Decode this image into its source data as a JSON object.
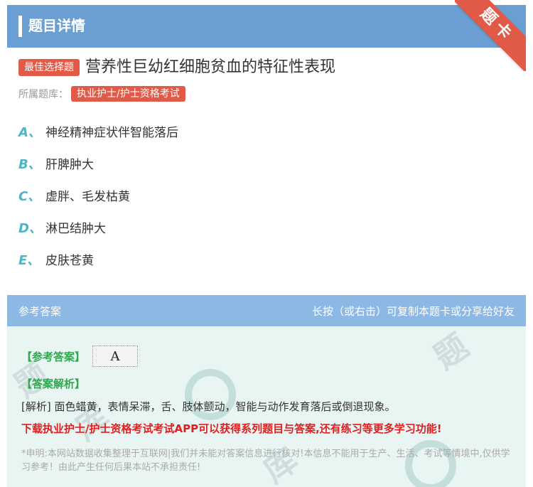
{
  "header": {
    "title": "题目详情"
  },
  "ribbon": {
    "label": "题卡"
  },
  "question": {
    "type_tag": "最佳选择题",
    "title": "营养性巨幼红细胞贫血的特征性表现",
    "bank_label": "所属题库：",
    "bank_name": "执业护士/护士资格考试",
    "options": [
      {
        "letter": "A、",
        "text": "神经精神症状伴智能落后"
      },
      {
        "letter": "B、",
        "text": "肝脾肿大"
      },
      {
        "letter": "C、",
        "text": "虚胖、毛发枯黄"
      },
      {
        "letter": "D、",
        "text": "淋巴结肿大"
      },
      {
        "letter": "E、",
        "text": "皮肤苍黄"
      }
    ]
  },
  "answer_bar": {
    "left": "参考答案",
    "right": "长按（或右击）可复制本题卡或分享给好友"
  },
  "answer": {
    "ref_label": "【参考答案】",
    "ref_value": "A",
    "analysis_label": "【答案解析】",
    "analysis_text": "[解析] 面色蜡黄，表情呆滞，舌、肢体颤动，智能与动作发育落后或倒退现象。",
    "promo": "下载执业护士/护士资格考试考试APP可以获得系列题目与答案,还有练习等更多学习功能!",
    "disclaimer": "*申明:本网站数据收集整理于互联网|我们并未能对答案信息进行核对!本信息不能用于生产、生活、考试等情境中,仅供学习参考！由此产生任何后果本站不承担责任!"
  },
  "colors": {
    "header_bg": "#6b9fd4",
    "accent_red": "#e05a47",
    "option_letter": "#4cb6c9",
    "answer_bar": "#8db8e3",
    "answer_bg": "#e9f5f3",
    "green": "#2fa84f",
    "promo_red": "#e02020"
  }
}
